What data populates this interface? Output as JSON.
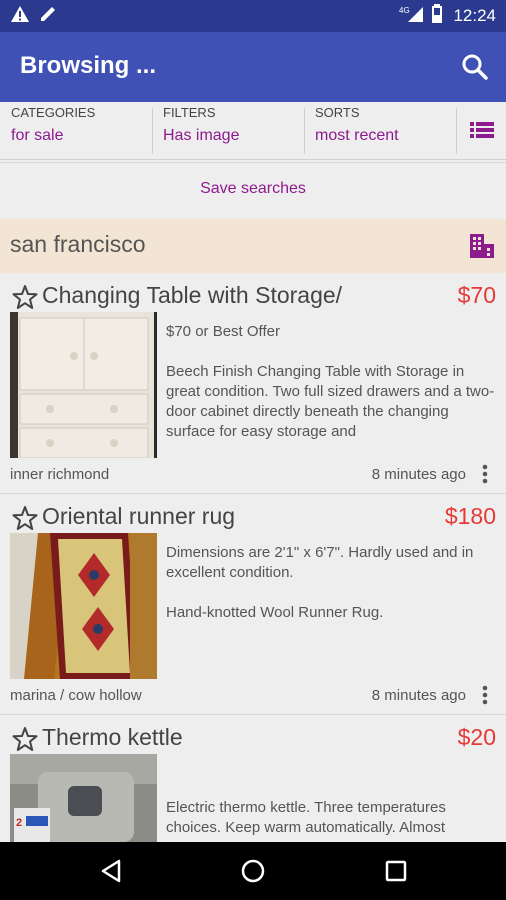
{
  "status_bar": {
    "time": "12:24",
    "network": "4G",
    "icons": [
      "warning-icon",
      "edit-icon",
      "signal-icon",
      "battery-icon"
    ]
  },
  "app_bar": {
    "title": "Browsing ...",
    "search_icon": "search-icon"
  },
  "filters": {
    "categories_label": "CATEGORIES",
    "categories_value": "for sale",
    "filters_label": "FILTERS",
    "filters_value": "Has image",
    "sorts_label": "SORTS",
    "sorts_value": "most recent",
    "list_icon": "list-icon"
  },
  "save_searches": "Save searches",
  "city": {
    "name": "san francisco",
    "icon": "city-icon"
  },
  "listings": [
    {
      "title": "Changing Table with Storage/",
      "price": "$70",
      "desc1": "$70 or Best Offer",
      "desc2": "Beech Finish Changing Table with Storage in great condition. Two full sized drawers and a two-door cabinet directly beneath the changing surface for easy storage and",
      "neighborhood": "inner richmond",
      "time_ago": "8 minutes ago"
    },
    {
      "title": "Oriental  runner rug",
      "price": "$180",
      "desc1": "Dimensions are 2'1\" x 6'7\". Hardly used and in excellent condition.",
      "desc2": "Hand-knotted Wool Runner Rug.",
      "neighborhood": "marina / cow hollow",
      "time_ago": "8 minutes ago"
    },
    {
      "title": "Thermo kettle",
      "price": "$20",
      "desc1": "Electric thermo kettle. Three temperatures choices. Keep warm automatically. Almost",
      "desc2": "",
      "neighborhood": "",
      "time_ago": ""
    }
  ],
  "colors": {
    "status_bar": "#2b3a8f",
    "app_bar": "#3f51b5",
    "accent": "#8e1b8e",
    "price": "#e53935",
    "city_bar": "#f2e5d4"
  }
}
